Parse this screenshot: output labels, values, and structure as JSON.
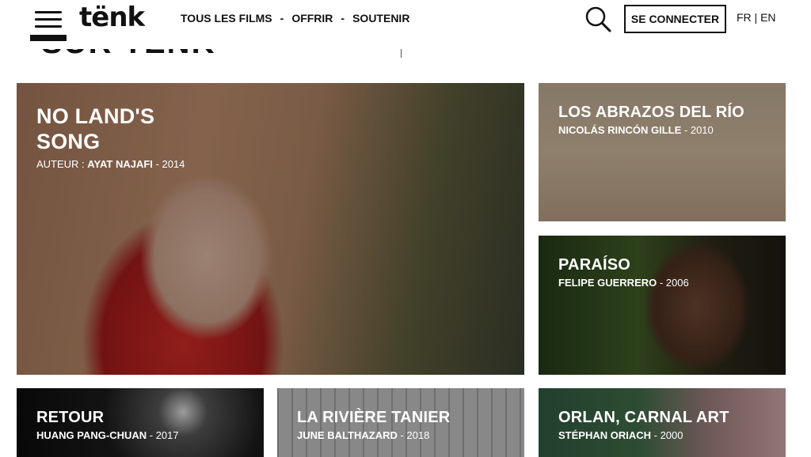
{
  "header": {
    "logo": "tënk",
    "nav": [
      {
        "label": "TOUS LES FILMS"
      },
      {
        "label": "OFFRIR"
      },
      {
        "label": "SOUTENIR"
      }
    ],
    "nav_separator": "-",
    "connect_label": "SE CONNECTER",
    "lang_fr": "FR",
    "lang_sep": " | ",
    "lang_en": "EN"
  },
  "peek_heading": "SUR TËNK",
  "films": {
    "main": {
      "title": "NO LAND'S SONG",
      "author_label": "AUTEUR : ",
      "author": "AYAT NAJAFI",
      "year": " - 2014"
    },
    "rio": {
      "title": "LOS ABRAZOS DEL RÍO",
      "author": "NICOLÁS RINCÓN GILLE",
      "year": " - 2010"
    },
    "paraiso": {
      "title": "PARAÍSO",
      "author": "FELIPE GUERRERO",
      "year": " - 2006"
    },
    "retour": {
      "title": "RETOUR",
      "author": "HUANG PANG-CHUAN",
      "year": " - 2017"
    },
    "tanier": {
      "title": "LA RIVIÈRE TANIER",
      "author": "JUNE BALTHAZARD",
      "year": " - 2018"
    },
    "orlan": {
      "title": "ORLAN, CARNAL ART",
      "author": "STÉPHAN ORIACH",
      "year": " - 2000"
    }
  }
}
